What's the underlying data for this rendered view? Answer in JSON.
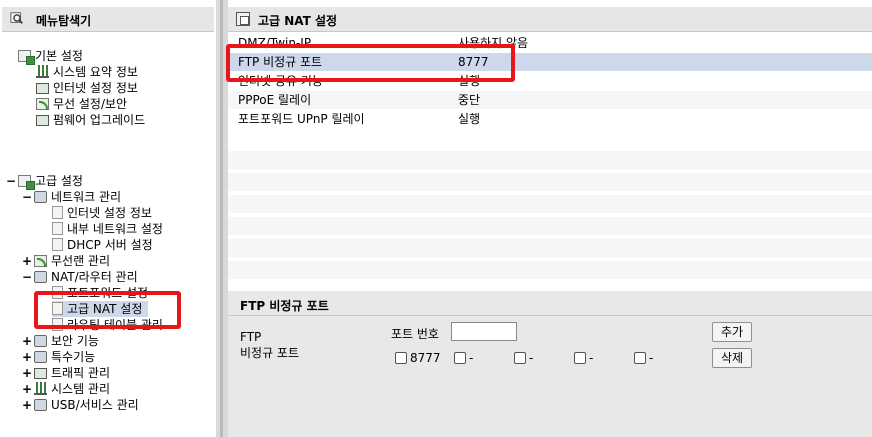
{
  "left_panel": {
    "title": "메뉴탐색기",
    "basic": {
      "label": "기본 설정",
      "items": [
        "시스템 요약 정보",
        "인터넷 설정 정보",
        "무선 설정/보안",
        "펌웨어 업그레이드"
      ]
    },
    "advanced": {
      "label": "고급 설정",
      "network": {
        "label": "네트워크 관리",
        "items": [
          "인터넷 설정 정보",
          "내부 네트워크 설정",
          "DHCP 서버 설정"
        ]
      },
      "wireless": "무선랜 관리",
      "nat": {
        "label": "NAT/라우터 관리",
        "items": [
          "포트포워드 설정",
          "고급 NAT 설정",
          "라우팅 테이블 관리"
        ]
      },
      "others": [
        "보안 기능",
        "특수기능",
        "트래픽 관리",
        "시스템 관리",
        "USB/서비스 관리"
      ]
    },
    "expand_plus": "+",
    "expand_minus": "−"
  },
  "main": {
    "title": "고급 NAT 설정",
    "rows": [
      {
        "key": "DMZ/Twin-IP",
        "value": "사용하지 않음"
      },
      {
        "key": "FTP 비정규 포트",
        "value": "8777"
      },
      {
        "key": "인터넷 공유 기능",
        "value": "실행"
      },
      {
        "key": "PPPoE 릴레이",
        "value": "중단"
      },
      {
        "key": "포트포워드 UPnP 릴레이",
        "value": "실행"
      }
    ],
    "detail": {
      "title": "FTP 비정규 포트",
      "label_line1": "FTP",
      "label_line2": "비정규 포트",
      "port_label": "포트 번호",
      "port_value": "",
      "add_button": "추가",
      "delete_button": "삭제",
      "ports": [
        "8777",
        "-",
        "-",
        "-",
        "-"
      ]
    }
  },
  "colors": {
    "highlight_red": "#e8161b",
    "selected_row": "#cdd9ea",
    "header_gray": "#e6e6e6"
  }
}
